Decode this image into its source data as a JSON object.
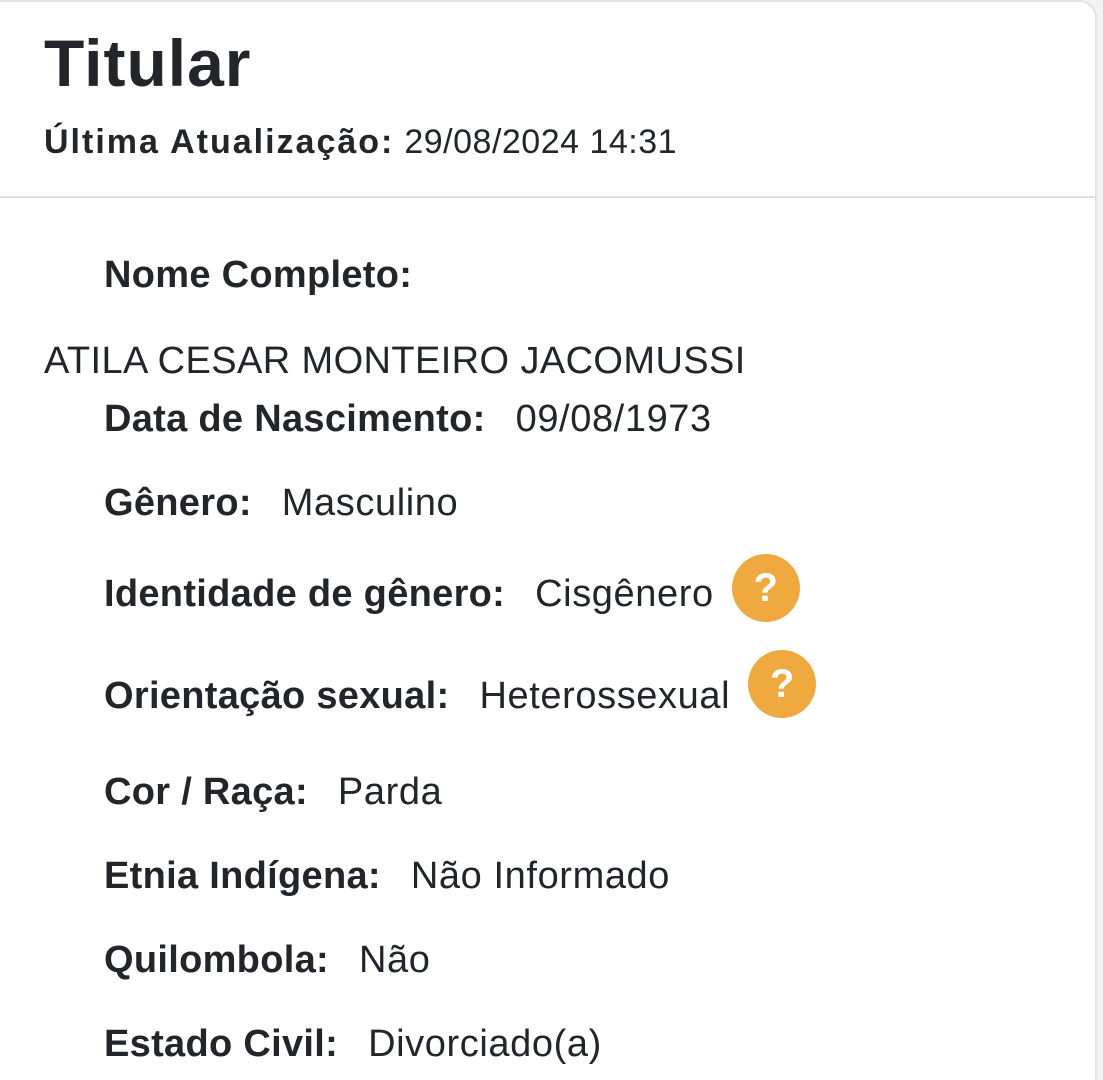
{
  "header": {
    "title": "Titular",
    "updated_label": "Última Atualização:",
    "updated_value": "29/08/2024 14:31"
  },
  "fields": {
    "nome_label": "Nome Completo:",
    "nome_value": "ATILA CESAR MONTEIRO JACOMUSSI",
    "nascimento_label": "Data de Nascimento:",
    "nascimento_value": "09/08/1973",
    "genero_label": "Gênero:",
    "genero_value": "Masculino",
    "identidade_label": "Identidade de gênero:",
    "identidade_value": "Cisgênero",
    "orientacao_label": "Orientação sexual:",
    "orientacao_value": "Heterossexual",
    "cor_label": "Cor / Raça:",
    "cor_value": "Parda",
    "etnia_label": "Etnia Indígena:",
    "etnia_value": "Não Informado",
    "quilombola_label": "Quilombola:",
    "quilombola_value": "Não",
    "estado_civil_label": "Estado Civil:",
    "estado_civil_value": "Divorciado(a)"
  },
  "icons": {
    "help_glyph": "?",
    "help_color": "#f0a93e"
  }
}
